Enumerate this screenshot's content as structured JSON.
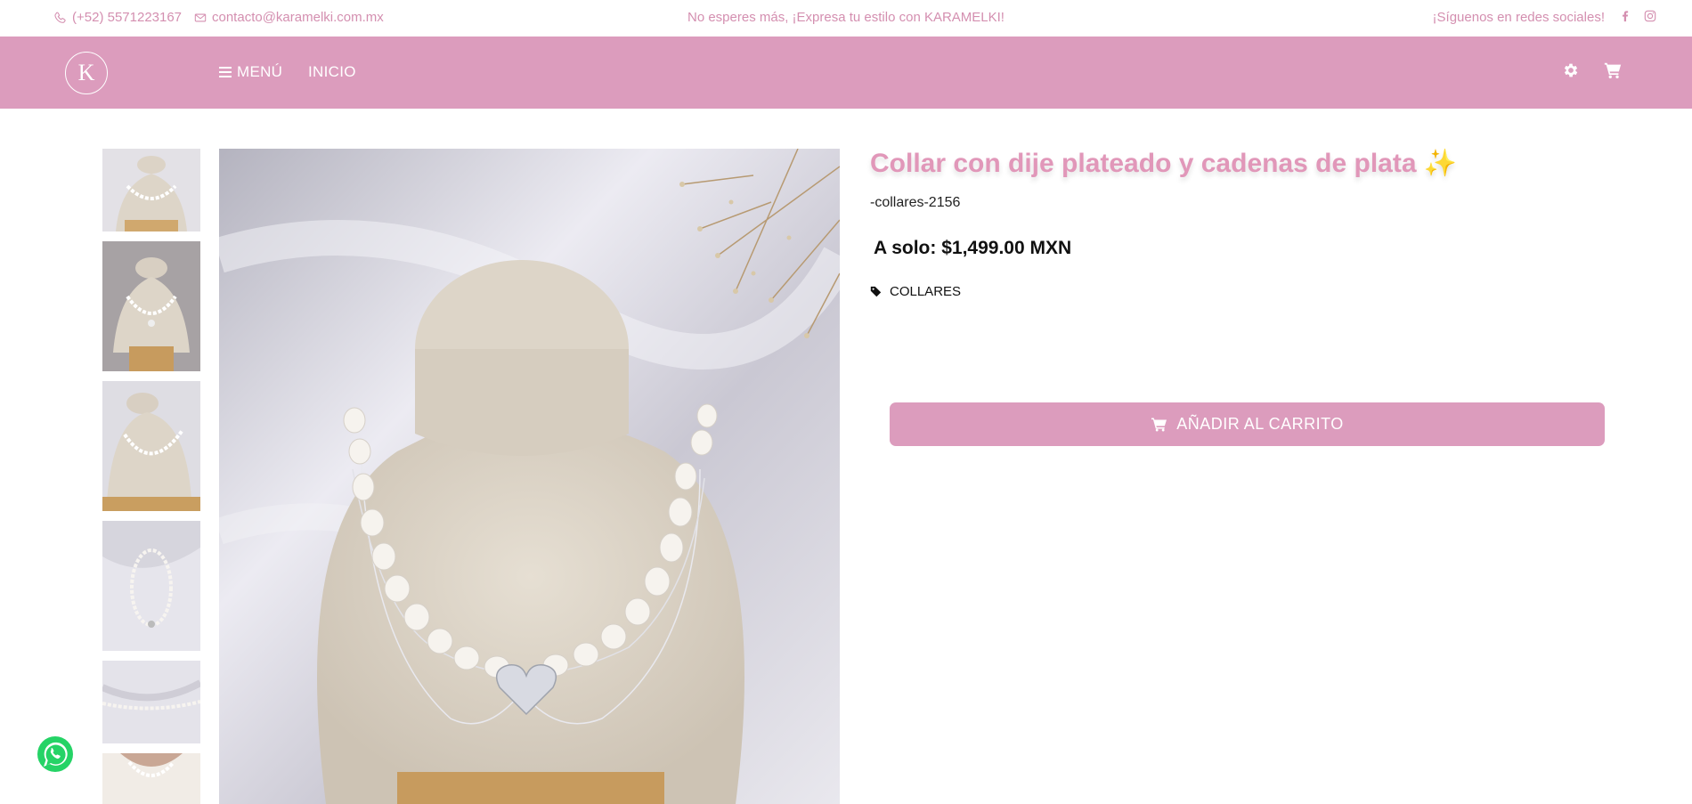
{
  "topbar": {
    "phone": "(+52) 5571223167",
    "email": "contacto@karamelki.com.mx",
    "promo": "No esperes más, ¡Expresa tu estilo con KARAMELKI!",
    "follow": "¡Síguenos en redes sociales!"
  },
  "nav": {
    "logo_letter": "K",
    "menu_label": "MENÚ",
    "home_label": "INICIO"
  },
  "product": {
    "title": "Collar con dije plateado y cadenas de plata ✨",
    "sku": "-collares-2156",
    "price": "A solo: $1,499.00 MXN",
    "category": "COLLARES",
    "add_to_cart": "AÑADIR AL CARRITO"
  },
  "colors": {
    "brand_pink": "#dc9cbd",
    "title_pink": "#e197b9",
    "topbar_text": "#d48fb0",
    "whatsapp_green": "#25d366"
  },
  "icons": {
    "phone": "phone-icon",
    "email": "envelope-icon",
    "facebook": "facebook-icon",
    "instagram": "instagram-icon",
    "settings": "gear-icon",
    "cart": "cart-icon",
    "tag": "tag-icon",
    "whatsapp": "whatsapp-icon"
  }
}
